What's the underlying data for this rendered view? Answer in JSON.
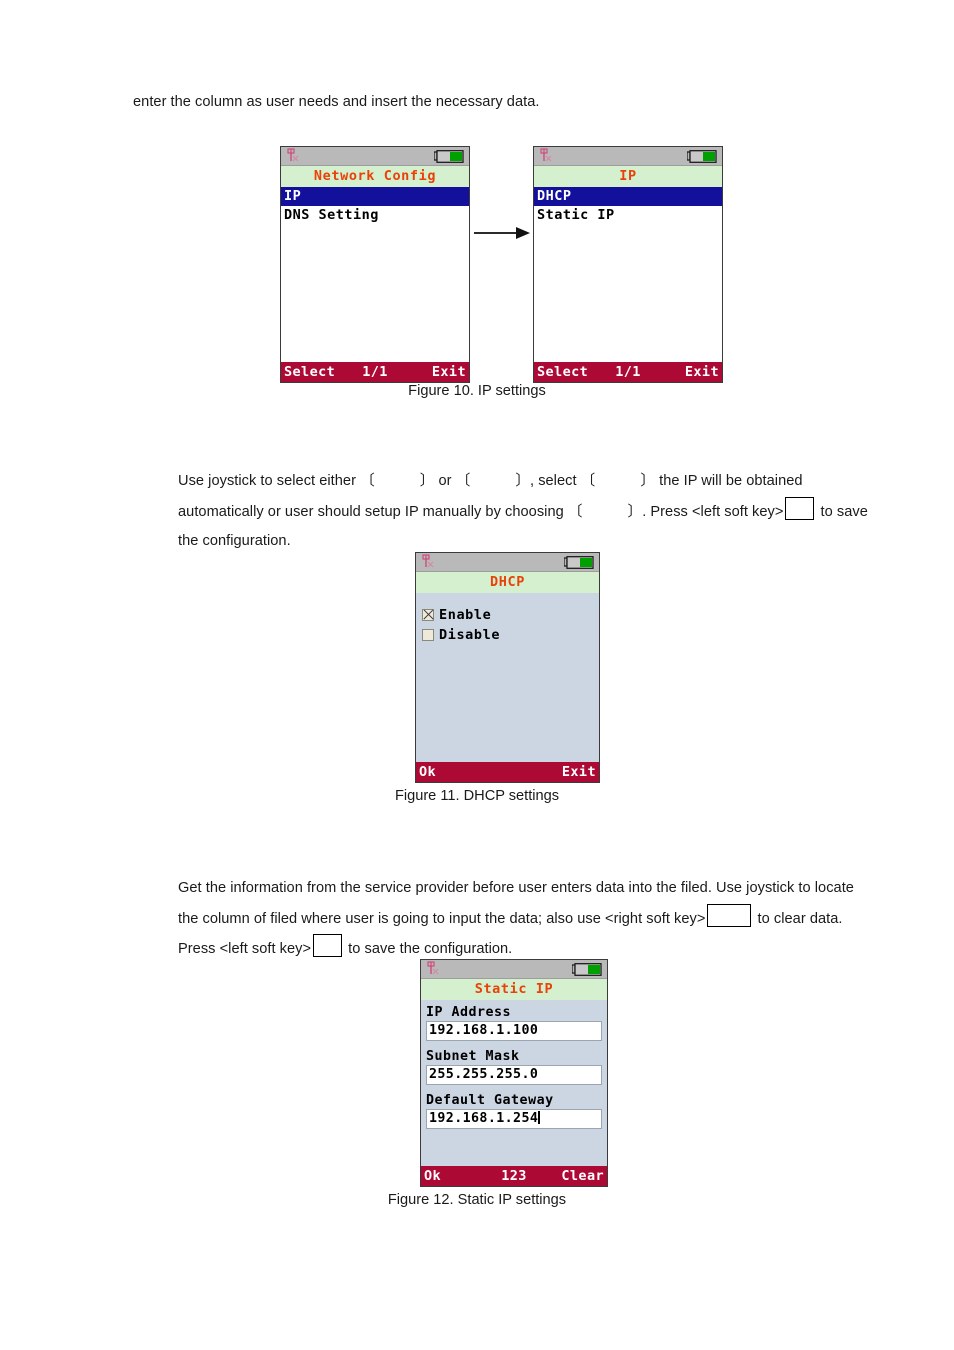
{
  "document": {
    "paragraphs": {
      "intro": "enter the column as user needs and insert the necessary data.",
      "ip_part1": "Use joystick to select either",
      "ip_part2": "or",
      "ip_part3": ", select",
      "ip_part4": "the IP will be obtained automatically or user should setup IP manually by choosing",
      "ip_part5": ". Press <left soft key>",
      "ip_part6": "to save the configuration.",
      "static_part1": "Get the information from the service provider before user enters data into the filed. Use joystick to locate the column of filed where user is going to input the data; also use <right soft key>",
      "static_part2": "to clear data. Press <left soft key>",
      "static_part3": "to save the configuration."
    },
    "bracket_placeholder": "〔           〕",
    "captions": {
      "fig10": "Figure 10. IP settings",
      "fig11": "Figure 11. DHCP settings",
      "fig12": "Figure 12. Static IP settings"
    }
  },
  "colors": {
    "titlebar_bg": "#d5f0ce",
    "titlebar_text": "#e8420a",
    "selected_bg": "#13119c",
    "softkey_bg": "#ad0935",
    "statusbar_bg": "#b9b9b9",
    "battery_fill": "#00a000",
    "signal_icon": "#d46a8c",
    "dialog_bg": "#ccd6e2"
  },
  "screens": {
    "network_config": {
      "status": {
        "signal_icon": "antenna-no-signal-icon",
        "battery_icon": "battery-icon"
      },
      "title": "Network Config",
      "items": [
        {
          "label": "IP",
          "selected": true
        },
        {
          "label": "DNS Setting",
          "selected": false
        }
      ],
      "softkeys": {
        "left": "Select",
        "middle": "1/1",
        "right": "Exit"
      }
    },
    "ip": {
      "status": {
        "signal_icon": "antenna-no-signal-icon",
        "battery_icon": "battery-icon"
      },
      "title": "IP",
      "items": [
        {
          "label": "DHCP",
          "selected": true
        },
        {
          "label": "Static IP",
          "selected": false
        }
      ],
      "softkeys": {
        "left": "Select",
        "middle": "1/1",
        "right": "Exit"
      }
    },
    "dhcp": {
      "status": {
        "signal_icon": "antenna-no-signal-icon",
        "battery_icon": "battery-icon"
      },
      "title": "DHCP",
      "options": [
        {
          "label": "Enable",
          "checked": true
        },
        {
          "label": "Disable",
          "checked": false
        }
      ],
      "softkeys": {
        "left": "Ok",
        "middle": "",
        "right": "Exit"
      }
    },
    "static_ip": {
      "status": {
        "signal_icon": "antenna-no-signal-icon",
        "battery_icon": "battery-icon"
      },
      "title": "Static IP",
      "fields": [
        {
          "label": "IP Address",
          "value": "192.168.1.100",
          "caret": false
        },
        {
          "label": "Subnet Mask",
          "value": "255.255.255.0",
          "caret": false
        },
        {
          "label": "Default Gateway",
          "value": "192.168.1.254",
          "caret": true
        }
      ],
      "softkeys": {
        "left": "Ok",
        "middle": "123",
        "right": "Clear"
      }
    }
  }
}
